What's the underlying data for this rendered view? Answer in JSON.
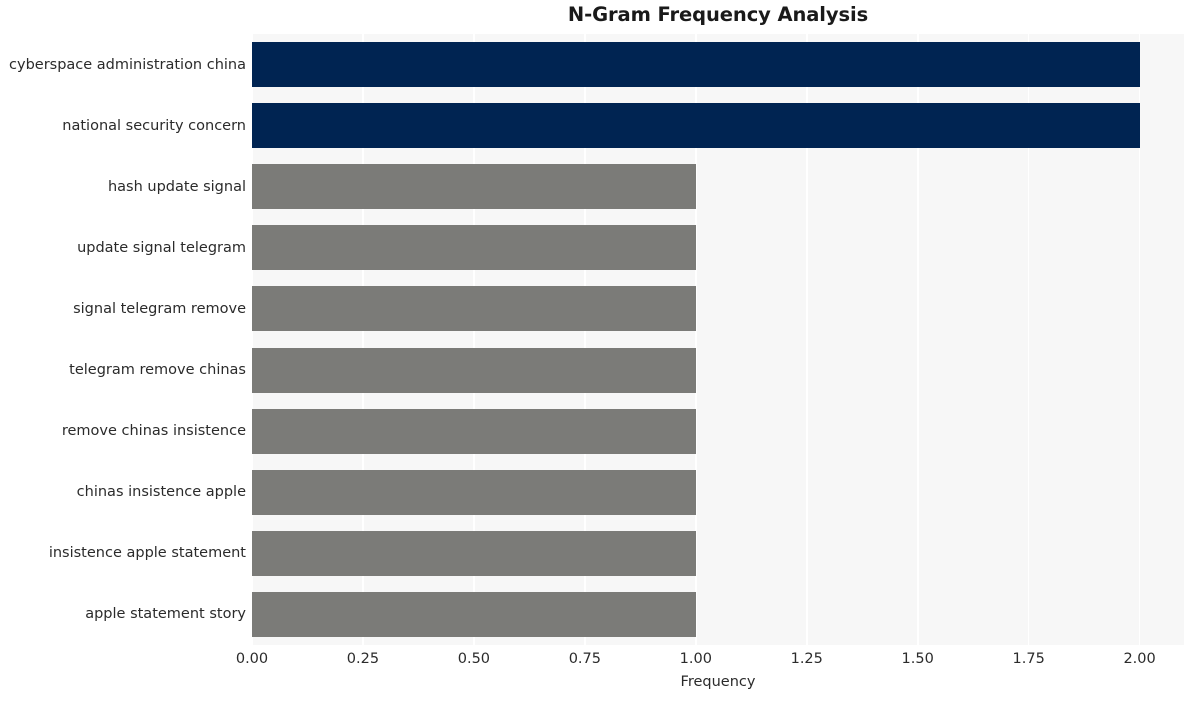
{
  "chart_data": {
    "type": "bar",
    "orientation": "horizontal",
    "title": "N-Gram Frequency Analysis",
    "xlabel": "Frequency",
    "ylabel": "",
    "categories": [
      "cyberspace administration china",
      "national security concern",
      "hash update signal",
      "update signal telegram",
      "signal telegram remove",
      "telegram remove chinas",
      "remove chinas insistence",
      "chinas insistence apple",
      "insistence apple statement",
      "apple statement story"
    ],
    "values": [
      2,
      2,
      1,
      1,
      1,
      1,
      1,
      1,
      1,
      1
    ],
    "bar_colors": [
      "#002452",
      "#002452",
      "#7b7b78",
      "#7b7b78",
      "#7b7b78",
      "#7b7b78",
      "#7b7b78",
      "#7b7b78",
      "#7b7b78",
      "#7b7b78"
    ],
    "xlim": [
      0,
      2.1
    ],
    "xticks": [
      0,
      0.25,
      0.5,
      0.75,
      1.0,
      1.25,
      1.5,
      1.75,
      2.0
    ],
    "xtick_labels": [
      "0.00",
      "0.25",
      "0.50",
      "0.75",
      "1.00",
      "1.25",
      "1.50",
      "1.75",
      "2.00"
    ],
    "grid": true,
    "grid_axis": "x",
    "legend": null,
    "style": {
      "plot_background": "#f7f7f7",
      "figure_background": "#ffffff",
      "gridline_color": "#ffffff",
      "text_color": "#2b2b2b",
      "title_color": "#1a1a1a",
      "highlight_color": "#002452",
      "default_bar_color": "#7b7b78"
    }
  }
}
